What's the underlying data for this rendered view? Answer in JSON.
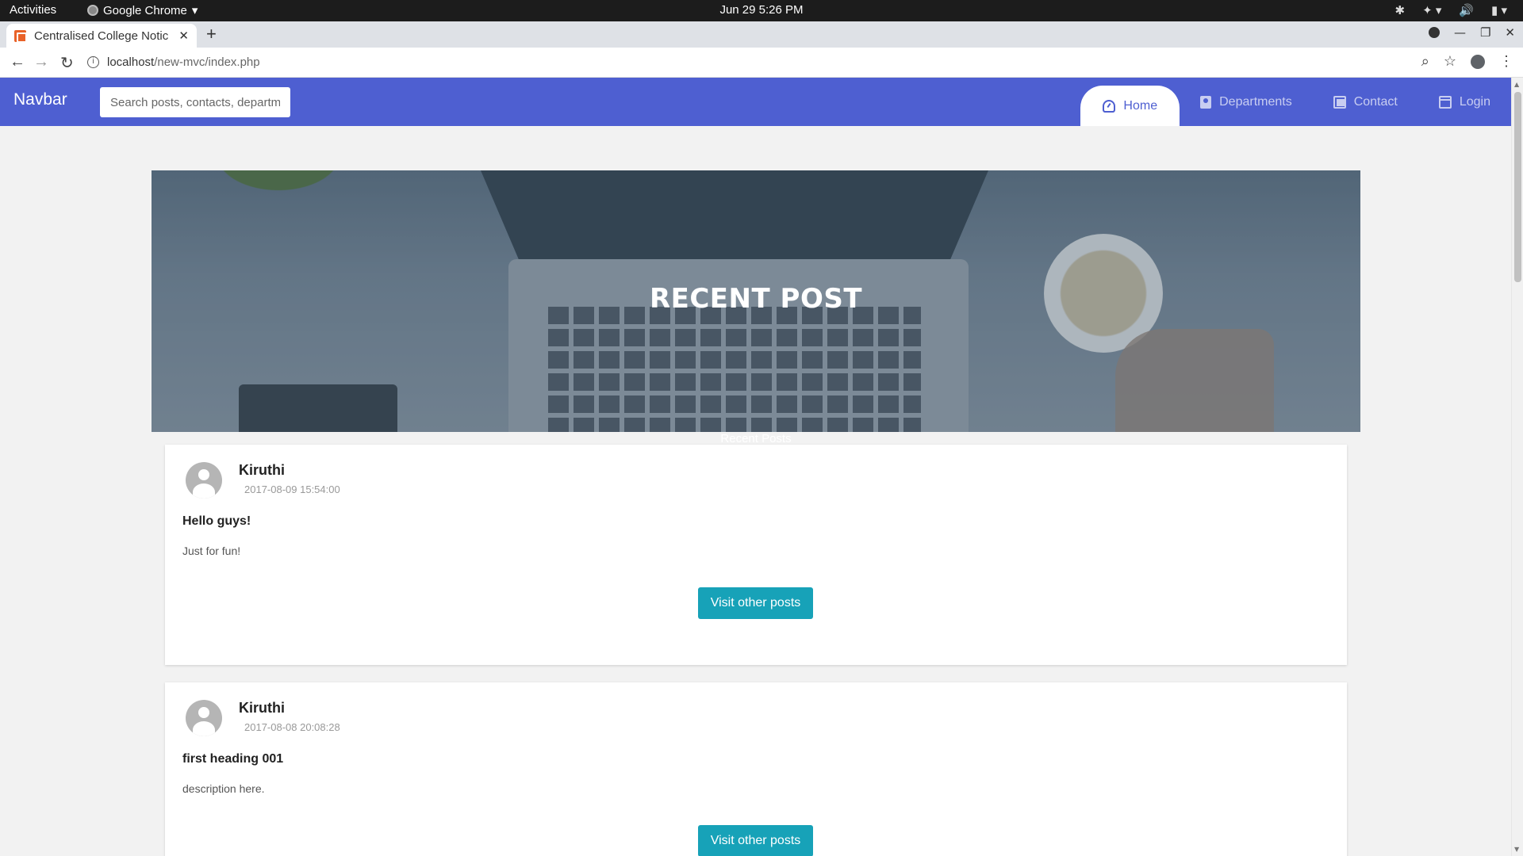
{
  "system_bar": {
    "activities": "Activities",
    "app_name": "Google Chrome",
    "clock": "Jun 29   5:26 PM"
  },
  "browser": {
    "tab_title": "Centralised College Notic",
    "url_host": "localhost",
    "url_path": "/new-mvc/index.php"
  },
  "navbar": {
    "brand": "Navbar",
    "search_placeholder": "Search posts, contacts, departm",
    "items": [
      {
        "label": "Home",
        "icon": "dashboard-icon",
        "active": true
      },
      {
        "label": "Departments",
        "icon": "contact-card-icon",
        "active": false
      },
      {
        "label": "Contact",
        "icon": "copy-icon",
        "active": false
      },
      {
        "label": "Login",
        "icon": "calendar-icon",
        "active": false
      }
    ]
  },
  "hero": {
    "title": "RECENT POST",
    "subtitle": "Recent Posts"
  },
  "posts": [
    {
      "author": "Kiruthi",
      "date": "2017-08-09 15:54:00",
      "heading": "Hello guys!",
      "body": "Just for fun!",
      "button": "Visit other posts"
    },
    {
      "author": "Kiruthi",
      "date": "2017-08-08 20:08:28",
      "heading": "first heading 001",
      "body": "description here.",
      "button": "Visit other posts"
    }
  ],
  "colors": {
    "navbar": "#4e5fd1",
    "button": "#17a2b8",
    "page_bg": "#f2f2f2"
  }
}
